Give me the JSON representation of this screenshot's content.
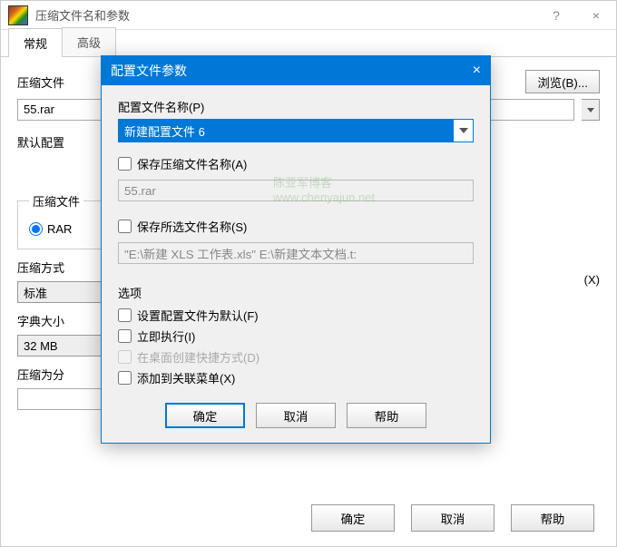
{
  "parent": {
    "title": "压缩文件名和参数",
    "help_icon": "?",
    "close_icon": "×",
    "tabs": {
      "general": "常规",
      "advanced": "高级"
    },
    "labels": {
      "archive_name": "压缩文件",
      "default_profile": "默认配置",
      "format": "压缩文件",
      "method": "压缩方式",
      "dict": "字典大小",
      "split": "压缩为分"
    },
    "archive_value": "55.rar",
    "browse": "浏览(B)...",
    "rar": "RAR",
    "method_value": "标准",
    "dict_value": "32 MB",
    "right_check_tail": "(X)",
    "buttons": {
      "ok": "确定",
      "cancel": "取消",
      "help": "帮助"
    }
  },
  "modal": {
    "title": "配置文件参数",
    "close_icon": "×",
    "profile_name_label": "配置文件名称(P)",
    "profile_name_value": "新建配置文件 6",
    "save_archive_name": "保存压缩文件名称(A)",
    "archive_name_value": "55.rar",
    "save_selected_files": "保存所选文件名称(S)",
    "selected_files_value": "\"E:\\新建 XLS 工作表.xls\" E:\\新建文本文档.t:",
    "options_label": "选项",
    "opt_default": "设置配置文件为默认(F)",
    "opt_run": "立即执行(I)",
    "opt_shortcut": "在桌面创建快捷方式(D)",
    "opt_context": "添加到关联菜单(X)",
    "buttons": {
      "ok": "确定",
      "cancel": "取消",
      "help": "帮助"
    }
  },
  "watermark": {
    "line1": "陈亚军博客",
    "line2": "www.chenyajun.net"
  }
}
